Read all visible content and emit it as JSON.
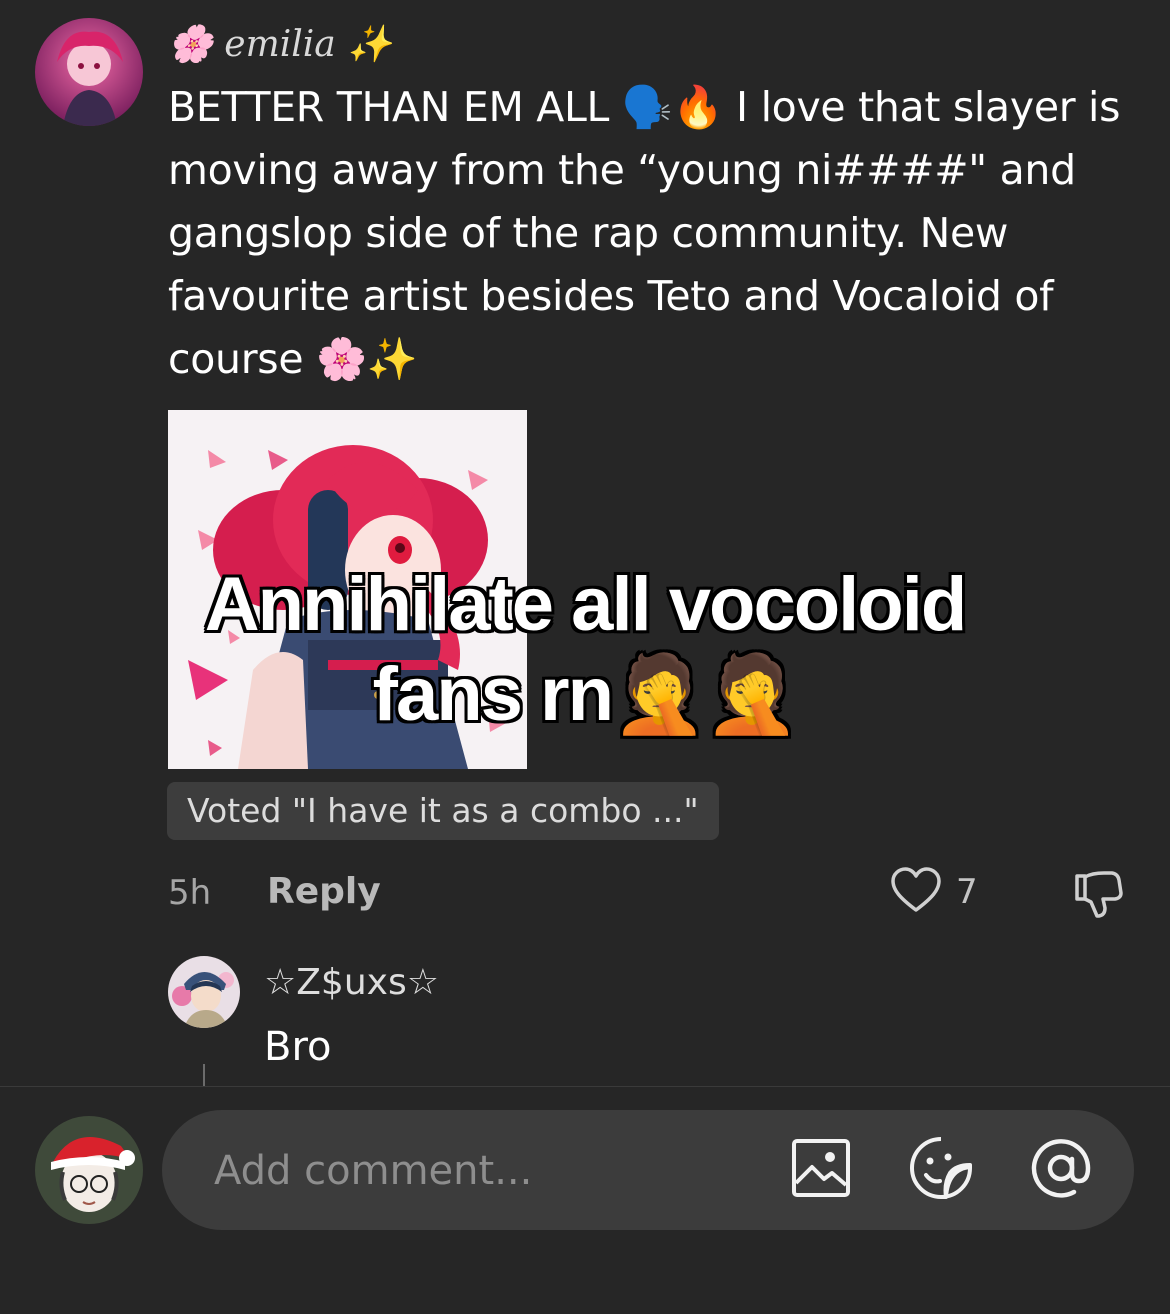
{
  "comment": {
    "username": "🌸 emilia ✨",
    "text": "BETTER THAN EM ALL 🗣️🔥 I love that slayer is moving away from the “young ni####\" and gangslop side of the rap community. New favourite artist besides Teto and Vocaloid of course 🌸✨",
    "media_caption": "Annihilate all vocoloid fans rn🤦🤦",
    "vote_label": "Voted \"I have it as a combo ...\"",
    "time": "5h",
    "reply_label": "Reply",
    "like_count": "7"
  },
  "reply": {
    "username": "☆Z$uxs☆",
    "text": "Bro"
  },
  "composer": {
    "placeholder": "Add comment..."
  },
  "icons": {
    "like": "heart-outline-icon",
    "dislike": "thumbs-down-icon",
    "image": "image-icon",
    "sticker": "emoji-sticker-icon",
    "mention": "at-sign-icon"
  },
  "colors": {
    "background": "#262626",
    "input": "#3c3c3c",
    "chip": "#3d3d3d"
  }
}
